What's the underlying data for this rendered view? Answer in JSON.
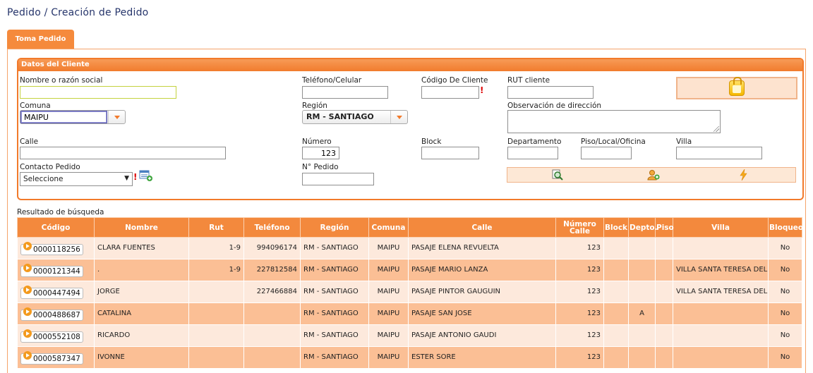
{
  "page": {
    "title": "Pedido / Creación de Pedido"
  },
  "tabs": [
    {
      "label": "Toma Pedido"
    }
  ],
  "client": {
    "header": "Datos del Cliente",
    "nombre_label": "Nombre o razón social",
    "nombre_value": "",
    "telefono_label": "Teléfono/Celular",
    "telefono_value": "",
    "codigo_label": "Código De Cliente",
    "codigo_value": "",
    "required_mark": "!",
    "rut_label": "RUT cliente",
    "rut_value": "",
    "comuna_label": "Comuna",
    "comuna_value": "MAIPU",
    "region_label": "Región",
    "region_value": "RM - SANTIAGO",
    "observacion_label": "Observación de dirección",
    "calle_label": "Calle",
    "calle_value": "",
    "numero_label": "Número",
    "numero_value": "123",
    "block_label": "Block",
    "block_value": "",
    "departamento_label": "Departamento",
    "departamento_value": "",
    "piso_label": "Piso/Local/Oficina",
    "piso_value": "",
    "villa_label": "Villa",
    "villa_value": "",
    "contacto_label": "Contacto Pedido",
    "contacto_value": "Seleccione",
    "contacto_arrow": "▼",
    "npedido_label": "N° Pedido",
    "npedido_value": ""
  },
  "results": {
    "label": "Resultado de búsqueda",
    "columns": [
      "Código",
      "Nombre",
      "Rut",
      "Teléfono",
      "Región",
      "Comuna",
      "Calle",
      "Número Calle",
      "Block",
      "Depto.",
      "Piso",
      "Villa",
      "Bloqueo"
    ],
    "rows": [
      [
        "0000118256",
        "CLARA FUENTES",
        "1-9",
        "994096174",
        "RM - SANTIAGO",
        "MAIPU",
        "PASAJE ELENA REVUELTA",
        "123",
        "",
        "",
        "",
        "",
        "No"
      ],
      [
        "0000121344",
        ".",
        "1-9",
        "227812584",
        "RM - SANTIAGO",
        "MAIPU",
        "PASAJE MARIO LANZA",
        "123",
        "",
        "",
        "",
        "VILLA SANTA TERESA DEL ROSAL",
        "No"
      ],
      [
        "0000447494",
        "JORGE",
        "",
        "227466884",
        "RM - SANTIAGO",
        "MAIPU",
        "PASAJE PINTOR GAUGUIN",
        "123",
        "",
        "",
        "",
        "VILLA SANTA TERESA DEL ROSAL",
        "No"
      ],
      [
        "0000488687",
        "CATALINA",
        "",
        "",
        "RM - SANTIAGO",
        "MAIPU",
        "PASAJE SAN JOSE",
        "123",
        "",
        "A",
        "",
        "",
        "No"
      ],
      [
        "0000552108",
        "RICARDO",
        "",
        "",
        "RM - SANTIAGO",
        "MAIPU",
        "PASAJE ANTONIO GAUDI",
        "123",
        "",
        "",
        "",
        "",
        "No"
      ],
      [
        "0000587347",
        "IVONNE",
        "",
        "",
        "RM - SANTIAGO",
        "MAIPU",
        "ESTER SORE",
        "123",
        "",
        "",
        "",
        "",
        "No"
      ]
    ]
  },
  "colors": {
    "accent": "#f27a2b",
    "header": "#f3893d",
    "row_light": "#fde9dc",
    "row_dark": "#fbbf95",
    "title": "#26356b"
  }
}
